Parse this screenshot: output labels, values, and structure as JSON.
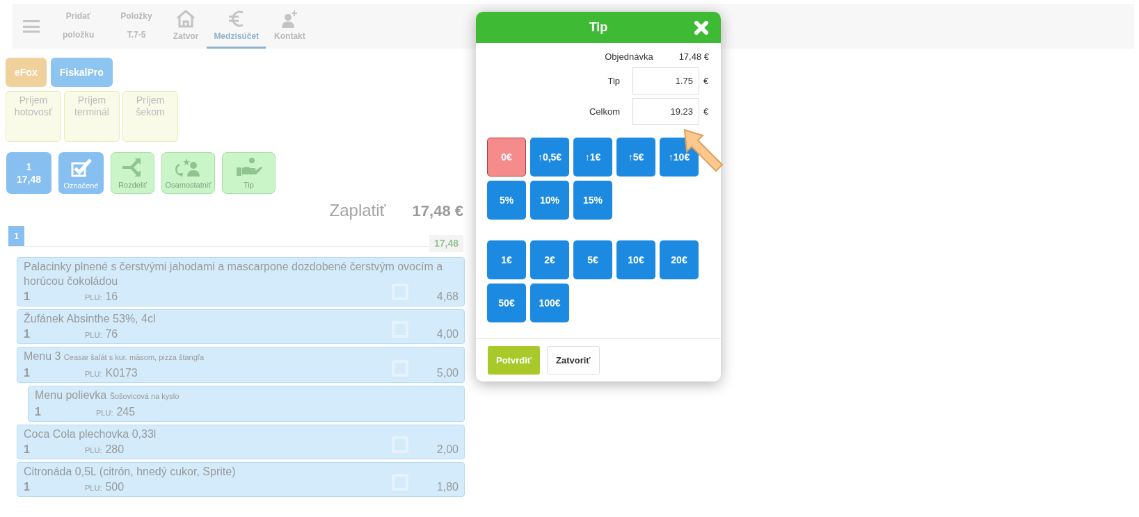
{
  "toolbar": {
    "tabs": [
      {
        "label": "Pridať\npoložku",
        "kind": "text",
        "selected": false
      },
      {
        "label": "Položky\nT.7-5",
        "kind": "text",
        "selected": false
      },
      {
        "label": "Zatvor",
        "kind": "house",
        "selected": false
      },
      {
        "label": "Medzisúčet",
        "kind": "euro",
        "selected": true
      },
      {
        "label": "Kontakt",
        "kind": "contact",
        "selected": false
      }
    ]
  },
  "fiscal_buttons": [
    {
      "label": "eFox",
      "color": "#f1d19b"
    },
    {
      "label": "FiskalPro",
      "color": "#8ec4f0"
    }
  ],
  "payment_buttons": [
    "Príjem hotovosť",
    "Príjem terminál",
    "Príjem šekom"
  ],
  "action_buttons": [
    {
      "kind": "count",
      "label": "1\n17,48"
    },
    {
      "kind": "marked",
      "label": "Označené"
    },
    {
      "kind": "split",
      "label": "Rozdeliť"
    },
    {
      "kind": "separate",
      "label": "Osamostatniť"
    },
    {
      "kind": "tip",
      "label": "Tip"
    }
  ],
  "total": {
    "label": "Zaplatiť",
    "value": "17,48 €"
  },
  "group": {
    "number": "1",
    "subtotal": "17,48"
  },
  "items": [
    {
      "kind": "item",
      "name": "Palacinky plnené s čerstvými jahodami a mascarpone dozdobené čerstvým ovocím a horúcou čokoládou",
      "qty": "1",
      "plu_label": "PLU:",
      "plu": "16",
      "price": "4,68",
      "checked": false
    },
    {
      "kind": "item",
      "name": "Žufánek Absinthe 53%, 4cl",
      "qty": "1",
      "plu_label": "PLU:",
      "plu": "76",
      "price": "4,00",
      "checked": false
    },
    {
      "kind": "item",
      "name": "Menu 3",
      "note": "Ceasar šalát s kur. mäsom, pizza štangľa",
      "qty": "1",
      "plu_label": "PLU:",
      "plu": "K0173",
      "price": "5,00",
      "checked": false
    },
    {
      "kind": "sub",
      "name": "Menu polievka",
      "note": "Šošovicová na kyslo",
      "qty": "1",
      "plu_label": "PLU:",
      "plu": "245"
    },
    {
      "kind": "item",
      "name": "Coca Cola plechovka 0,33l",
      "qty": "1",
      "plu_label": "PLU:",
      "plu": "280",
      "price": "2,00",
      "checked": false
    },
    {
      "kind": "item",
      "name": "Citronáda 0,5L (citrón, hnedý cukor, Sprite)",
      "qty": "1",
      "plu_label": "PLU:",
      "plu": "500",
      "price": "1,80",
      "checked": false
    }
  ],
  "dialog": {
    "title": "Tip",
    "order_label": "Objednávka",
    "order_value": "17,48 €",
    "tip_label": "Tip",
    "tip_value": "1.75",
    "tip_currency": "€",
    "total_label": "Celkom",
    "total_value": "19.23",
    "total_currency": "€",
    "button_groups": [
      {
        "rows": [
          {
            "buttons": [
              {
                "label": "0€",
                "kind": "reset"
              },
              {
                "label": "↑0,5€",
                "kind": "amount"
              },
              {
                "label": "↑1€",
                "kind": "amount"
              },
              {
                "label": "↑5€",
                "kind": "amount"
              },
              {
                "label": "↑10€",
                "kind": "amount"
              }
            ]
          },
          {
            "buttons": [
              {
                "label": "5%",
                "kind": "amount"
              },
              {
                "label": "10%",
                "kind": "amount"
              },
              {
                "label": "15%",
                "kind": "amount"
              }
            ]
          }
        ]
      },
      {
        "rows": [
          {
            "buttons": [
              {
                "label": "1€",
                "kind": "amount"
              },
              {
                "label": "2€",
                "kind": "amount"
              },
              {
                "label": "5€",
                "kind": "amount"
              },
              {
                "label": "10€",
                "kind": "amount"
              },
              {
                "label": "20€",
                "kind": "amount"
              }
            ]
          },
          {
            "buttons": [
              {
                "label": "50€",
                "kind": "amount"
              },
              {
                "label": "100€",
                "kind": "amount"
              }
            ]
          }
        ]
      }
    ],
    "confirm": "Potvrdiť",
    "close": "Zatvoriť"
  }
}
